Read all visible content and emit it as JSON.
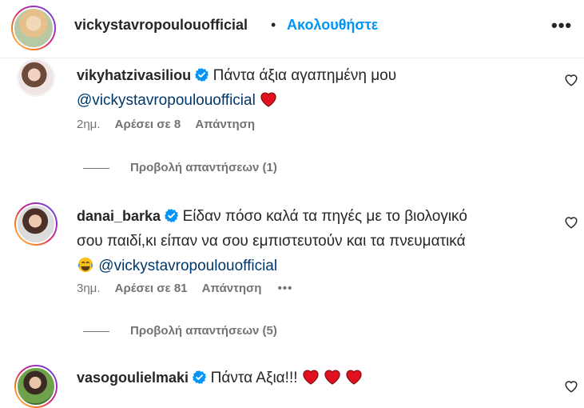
{
  "header": {
    "username": "vickystavropoulouofficial",
    "separator": "•",
    "follow_label": "Ακολουθήστε",
    "more": "•••"
  },
  "comments": [
    {
      "username": "vikyhatzivasiliou",
      "text": "Πάντα άξια αγαπημένη μου",
      "mention": "@vickystavropoulouofficial",
      "time": "2ημ.",
      "likes": "Αρέσει σε 8",
      "reply": "Απάντηση",
      "view_replies": "Προβολή απαντήσεων (1)"
    },
    {
      "username": "danai_barka",
      "text_line1": "Είδαν πόσο καλά τα πηγές με το βιολογικό",
      "text_line2": "σου παιδί,κι είπαν να σου εμπιστευτούν και τα πνευματικά",
      "mention": "@vickystavropoulouofficial",
      "time": "3ημ.",
      "likes": "Αρέσει σε 81",
      "reply": "Απάντηση",
      "more": "•••",
      "view_replies": "Προβολή απαντήσεων (5)"
    },
    {
      "username": "vasogoulielmaki",
      "text": "Πάντα Αξια!!!"
    }
  ],
  "colors": {
    "link_blue": "#0095f6",
    "mention_blue": "#00376b",
    "verified_blue": "#0095f6",
    "heart_red": "#e0101e"
  }
}
